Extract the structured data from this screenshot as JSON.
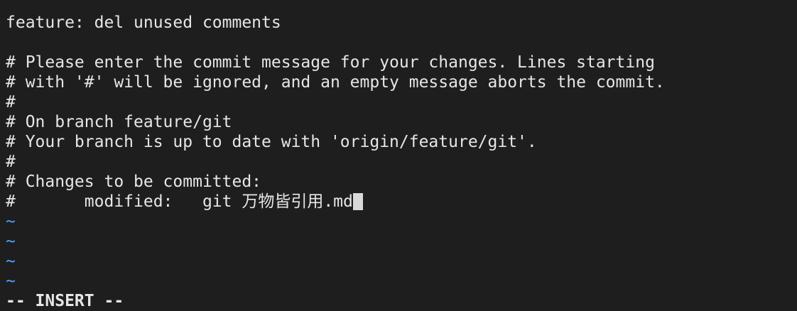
{
  "buffer": {
    "lines": [
      "feature: del unused comments",
      "",
      "# Please enter the commit message for your changes. Lines starting",
      "# with '#' will be ignored, and an empty message aborts the commit.",
      "#",
      "# On branch feature/git",
      "# Your branch is up to date with 'origin/feature/git'.",
      "#",
      "# Changes to be committed:",
      "#\tmodified:   git 万物皆引用.md"
    ],
    "tilde": "~"
  },
  "status": {
    "mode": "-- INSERT --"
  },
  "colors": {
    "background": "#1e1e1e",
    "text": "#e6e6e6",
    "tilde": "#4aa3ff",
    "cursor": "#d9d9d9"
  }
}
